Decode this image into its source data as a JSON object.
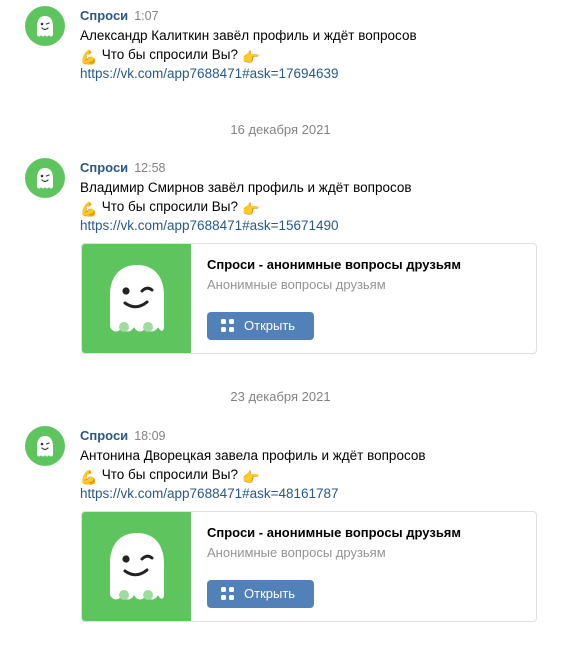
{
  "colors": {
    "accent_green": "#5ec55e",
    "link": "#2a5885",
    "button": "#5181b8",
    "muted": "#828282"
  },
  "messages": [
    {
      "sender": "Спроси",
      "time": "1:07",
      "text": "Александр Калиткин завёл профиль и ждёт вопросов",
      "emoji_left": "💪",
      "prompt": "Что бы спросили Вы?",
      "emoji_right": "👉",
      "link": "https://vk.com/app7688471#ask=17694639"
    },
    {
      "sender": "Спроси",
      "time": "12:58",
      "text": "Владимир Смирнов завёл профиль и ждёт вопросов",
      "emoji_left": "💪",
      "prompt": "Что бы спросили Вы?",
      "emoji_right": "👉",
      "link": "https://vk.com/app7688471#ask=15671490",
      "card": {
        "title": "Спроси - анонимные вопросы друзьям",
        "subtitle": "Анонимные вопросы друзьям",
        "button_label": "Открыть"
      }
    },
    {
      "sender": "Спроси",
      "time": "18:09",
      "text": "Антонина Дворецкая завела профиль и ждёт вопросов",
      "emoji_left": "💪",
      "prompt": "Что бы спросили Вы?",
      "emoji_right": "👉",
      "link": "https://vk.com/app7688471#ask=48161787",
      "card": {
        "title": "Спроси - анонимные вопросы друзьям",
        "subtitle": "Анонимные вопросы друзьям",
        "button_label": "Открыть"
      }
    }
  ],
  "date_separators": [
    "16 декабря 2021",
    "23 декабря 2021"
  ]
}
